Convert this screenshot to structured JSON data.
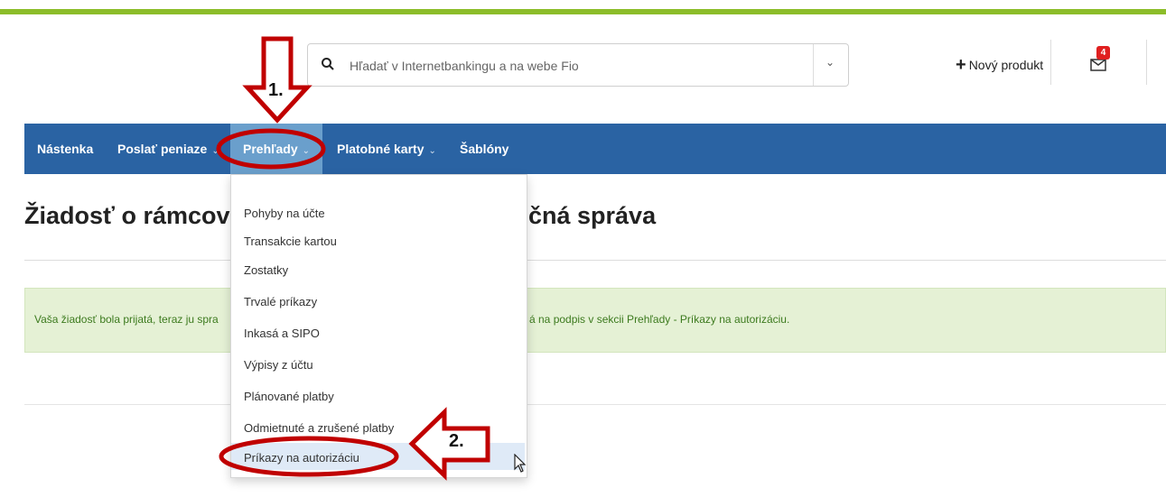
{
  "search": {
    "placeholder": "Hľadať v Internetbankingu a na webe Fio"
  },
  "header": {
    "new_product_label": "Nový produkt",
    "mail_badge": "4"
  },
  "nav": {
    "items": [
      {
        "label": "Nástenka",
        "dropdown": false
      },
      {
        "label": "Poslať peniaze",
        "dropdown": true
      },
      {
        "label": "Prehľady",
        "dropdown": true
      },
      {
        "label": "Platobné karty",
        "dropdown": true
      },
      {
        "label": "Šablóny",
        "dropdown": false
      }
    ],
    "active": "Prehľady"
  },
  "page": {
    "title_visible_left": "Žiadosť o rámcovú",
    "title_visible_right": "čná správa",
    "alert_left": "Vaša žiadosť bola prijatá, teraz ju spra",
    "alert_right": "á na podpis v sekcii Prehľady - Príkazy na autorizáciu."
  },
  "dropdown": {
    "items": [
      "Pohyby na účte",
      "Transakcie kartou",
      "Zostatky",
      "Trvalé príkazy",
      "Inkasá a SIPO",
      "Výpisy z účtu",
      "Plánované platby",
      "Odmietnuté a zrušené platby",
      "Príkazy na autorizáciu"
    ],
    "highlighted": "Príkazy na autorizáciu"
  },
  "annotations": {
    "step1": "1.",
    "step2": "2.",
    "color": "#c00000"
  },
  "colors": {
    "top_line": "#8cbd2a",
    "nav_bg": "#2a63a3",
    "nav_active": "#6a9fcc",
    "alert_bg": "#e5f1d5",
    "alert_text": "#3c7a1e"
  }
}
